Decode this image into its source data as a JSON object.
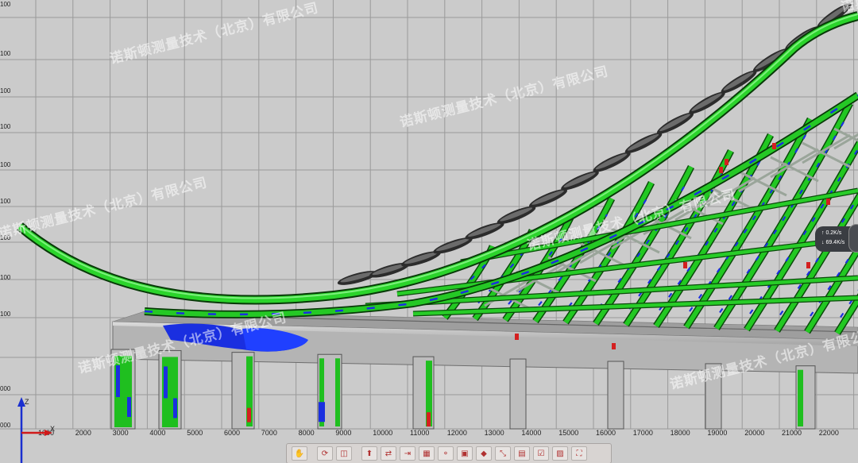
{
  "x_axis": {
    "labels": [
      "1000",
      "2000",
      "3000",
      "4000",
      "5000",
      "6000",
      "7000",
      "8000",
      "9000",
      "10000",
      "11000",
      "12000",
      "13000",
      "14000",
      "15000",
      "16000",
      "17000",
      "18000",
      "19000",
      "20000",
      "21000",
      "22000"
    ],
    "axis_name": "X"
  },
  "y_axis_labels": [
    "100",
    "100",
    "100",
    "100",
    "100",
    "100",
    "100",
    "100",
    "100",
    "000",
    "000"
  ],
  "triad": {
    "z_label": "Z",
    "x_label": "X"
  },
  "watermark": "诺斯顿测量技术（北京）有限公司",
  "speed_widget": {
    "line1": "0.2K/s",
    "line2": "69.4K/s"
  },
  "toolbar": {
    "buttons": [
      "hand-icon",
      "rotate-icon",
      "split-icon",
      "pin-icon",
      "arrow-icon",
      "measure-icon",
      "grid-icon",
      "node-icon",
      "frame-icon",
      "cube-icon",
      "diagonal-icon",
      "layers-icon",
      "check-icon",
      "image-icon",
      "expand-icon"
    ]
  },
  "colors": {
    "background": "#cbcbcb",
    "grid": "#9a9a9a",
    "in_tolerance": "#1fbf1f",
    "deviation_negative": "#1a2fe0",
    "deviation_positive": "#d42020",
    "structure": "#a8a8a8"
  }
}
